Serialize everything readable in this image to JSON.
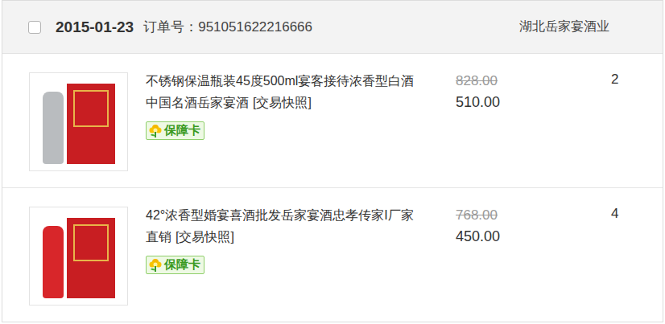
{
  "order": {
    "checked": false,
    "date": "2015-01-23",
    "order_label": "订单号：",
    "order_no": "951051622216666",
    "shop": "湖北岳家宴酒业"
  },
  "items": [
    {
      "kind": "steel",
      "title": "不锈钢保温瓶装45度500ml宴客接待浓香型白酒中国名酒岳家宴酒",
      "snapshot": "[交易快照]",
      "badge": "保障卡",
      "original_price": "828.00",
      "price": "510.00",
      "quantity": "2"
    },
    {
      "kind": "red",
      "title": "42°浓香型婚宴喜酒批发岳家宴酒忠孝传家I厂家直销",
      "snapshot": "[交易快照]",
      "badge": "保障卡",
      "original_price": "768.00",
      "price": "450.00",
      "quantity": "4"
    }
  ]
}
